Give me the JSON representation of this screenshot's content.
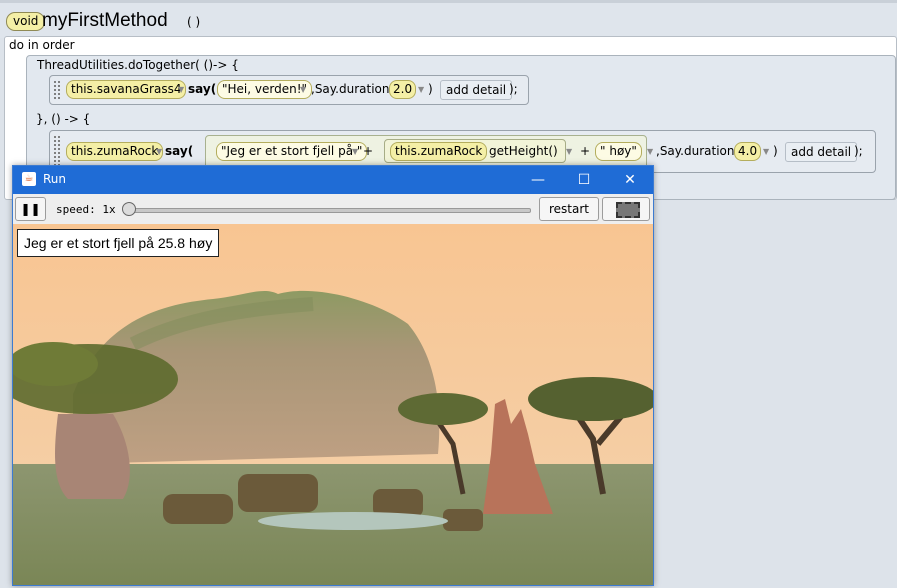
{
  "editor": {
    "return_type": "void",
    "method_name": "myFirstMethod",
    "method_params": "( )",
    "do_in_order_label": "do in order",
    "together_label": "ThreadUtilities.doTogether( ()-> {",
    "lambda_separator": "}, () -> {",
    "statement1": {
      "target": "this.savanaGrass4",
      "method": "say(",
      "text_arg": "\"Hei, verden!\"",
      "duration_label": ",Say.duration(",
      "duration_value": "2.0",
      "close_paren": ")",
      "detail_label": "add detail",
      "terminator": ");"
    },
    "statement2": {
      "target": "this.zumaRock",
      "method": "say(",
      "text_arg": "\"Jeg er et stort fjell på \"",
      "plus1": "+",
      "inner_target": "this.zumaRock",
      "inner_method": "getHeight()",
      "plus2": "+",
      "text_arg2": "\" høy\"",
      "duration_label": ",Say.duration(",
      "duration_value": "4.0",
      "close_paren": ")",
      "detail_label": "add detail",
      "terminator": ");"
    }
  },
  "run_window": {
    "title": "Run",
    "minimize_glyph": "—",
    "maximize_glyph": "☐",
    "close_glyph": "✕",
    "pause_glyph": "❚❚",
    "speed_label": "speed: 1x",
    "restart_label": "restart",
    "speech_bubble": "Jeg er et stort fjell på 25.8 høy"
  },
  "icons": {
    "app": "java-cup-icon",
    "pause": "pause-icon",
    "fullscreen": "fullscreen-icon"
  },
  "colors": {
    "titlebar": "#1f6cd6",
    "pill": "#f4efa6",
    "sky": "#f6c99a",
    "ground": "#8e9a63"
  }
}
